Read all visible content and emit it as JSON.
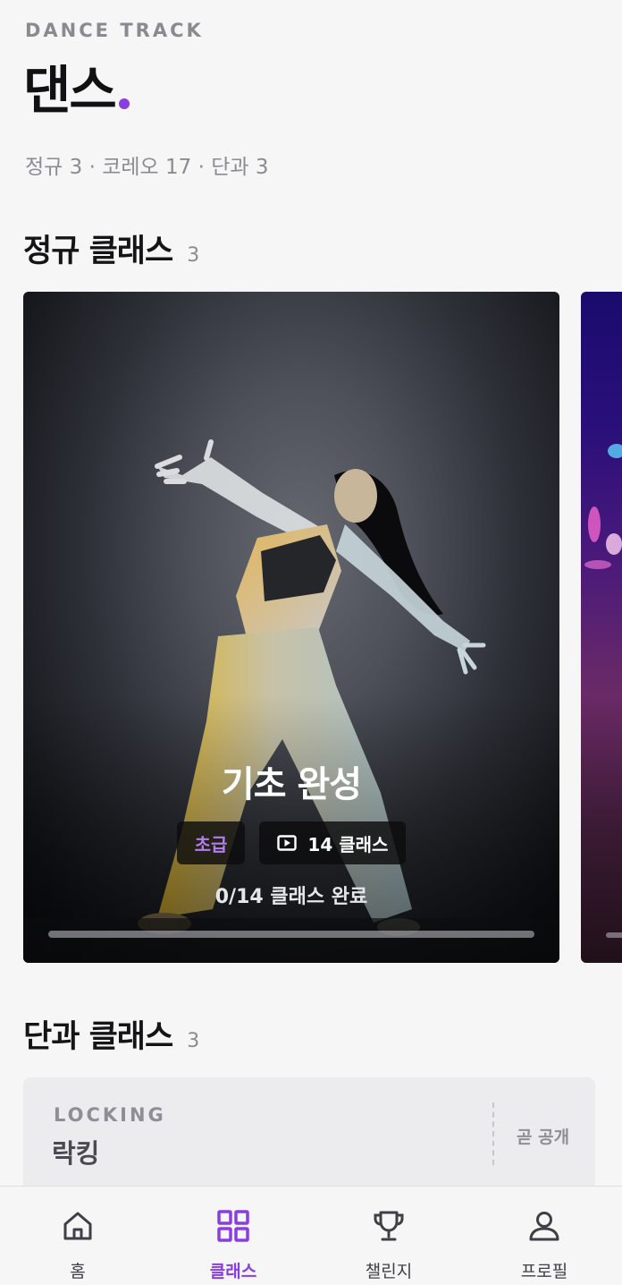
{
  "header": {
    "eyebrow": "DANCE TRACK",
    "title": "댄스",
    "summary": "정규 3 · 코레오 17 · 단과 3"
  },
  "colors": {
    "accent": "#8a3ee0",
    "background": "#f6f6f7",
    "text": "#151517",
    "muted": "#8b8b92"
  },
  "regular": {
    "title": "정규 클래스",
    "count": "3",
    "cards": [
      {
        "title": "기초 완성",
        "level": "초급",
        "lessons": "14 클래스",
        "progress_text": "0/14 클래스 완료",
        "progress": 0
      }
    ]
  },
  "single": {
    "title": "단과 클래스",
    "count": "3",
    "items": [
      {
        "eng": "LOCKING",
        "kor": "락킹",
        "status": "곧 공개"
      }
    ]
  },
  "tabbar": {
    "items": [
      {
        "label": "홈",
        "icon": "home-icon",
        "active": false
      },
      {
        "label": "클래스",
        "icon": "grid-icon",
        "active": true
      },
      {
        "label": "챌린지",
        "icon": "trophy-icon",
        "active": false
      },
      {
        "label": "프로필",
        "icon": "person-icon",
        "active": false
      }
    ]
  }
}
